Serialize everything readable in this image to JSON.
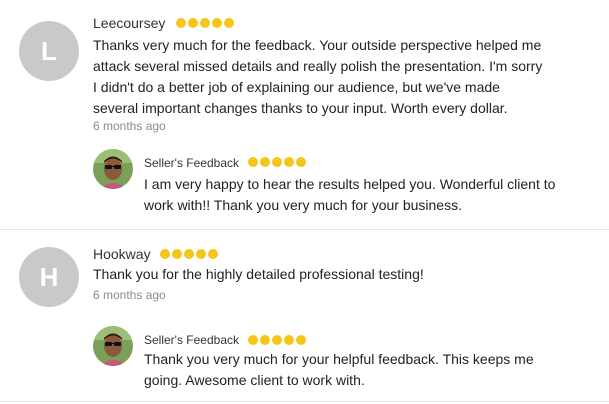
{
  "reviews": [
    {
      "avatar_letter": "L",
      "name": "Leecoursey",
      "rating": 5,
      "text": "Thanks very much for the feedback. Your outside perspective helped me attack several missed details and really polish the presentation. I'm sorry I didn't do a better job of explaining our audience, but we've made several important changes thanks to your input. Worth every dollar.",
      "time": "6 months ago",
      "reply": {
        "label": "Seller's Feedback",
        "rating": 5,
        "text": "I am very happy to hear the results helped you. Wonderful client to work with!! Thank you very much for your business."
      }
    },
    {
      "avatar_letter": "H",
      "name": "Hookway",
      "rating": 5,
      "text": "Thank you for the highly detailed professional testing!",
      "time": "6 months ago",
      "reply": {
        "label": "Seller's Feedback",
        "rating": 5,
        "text": "Thank you very much for your helpful feedback. This keeps me going. Awesome client to work with."
      }
    }
  ],
  "colors": {
    "star": "#f5c518",
    "avatar_bg": "#c9c9c9",
    "muted": "#8a8a8a"
  }
}
